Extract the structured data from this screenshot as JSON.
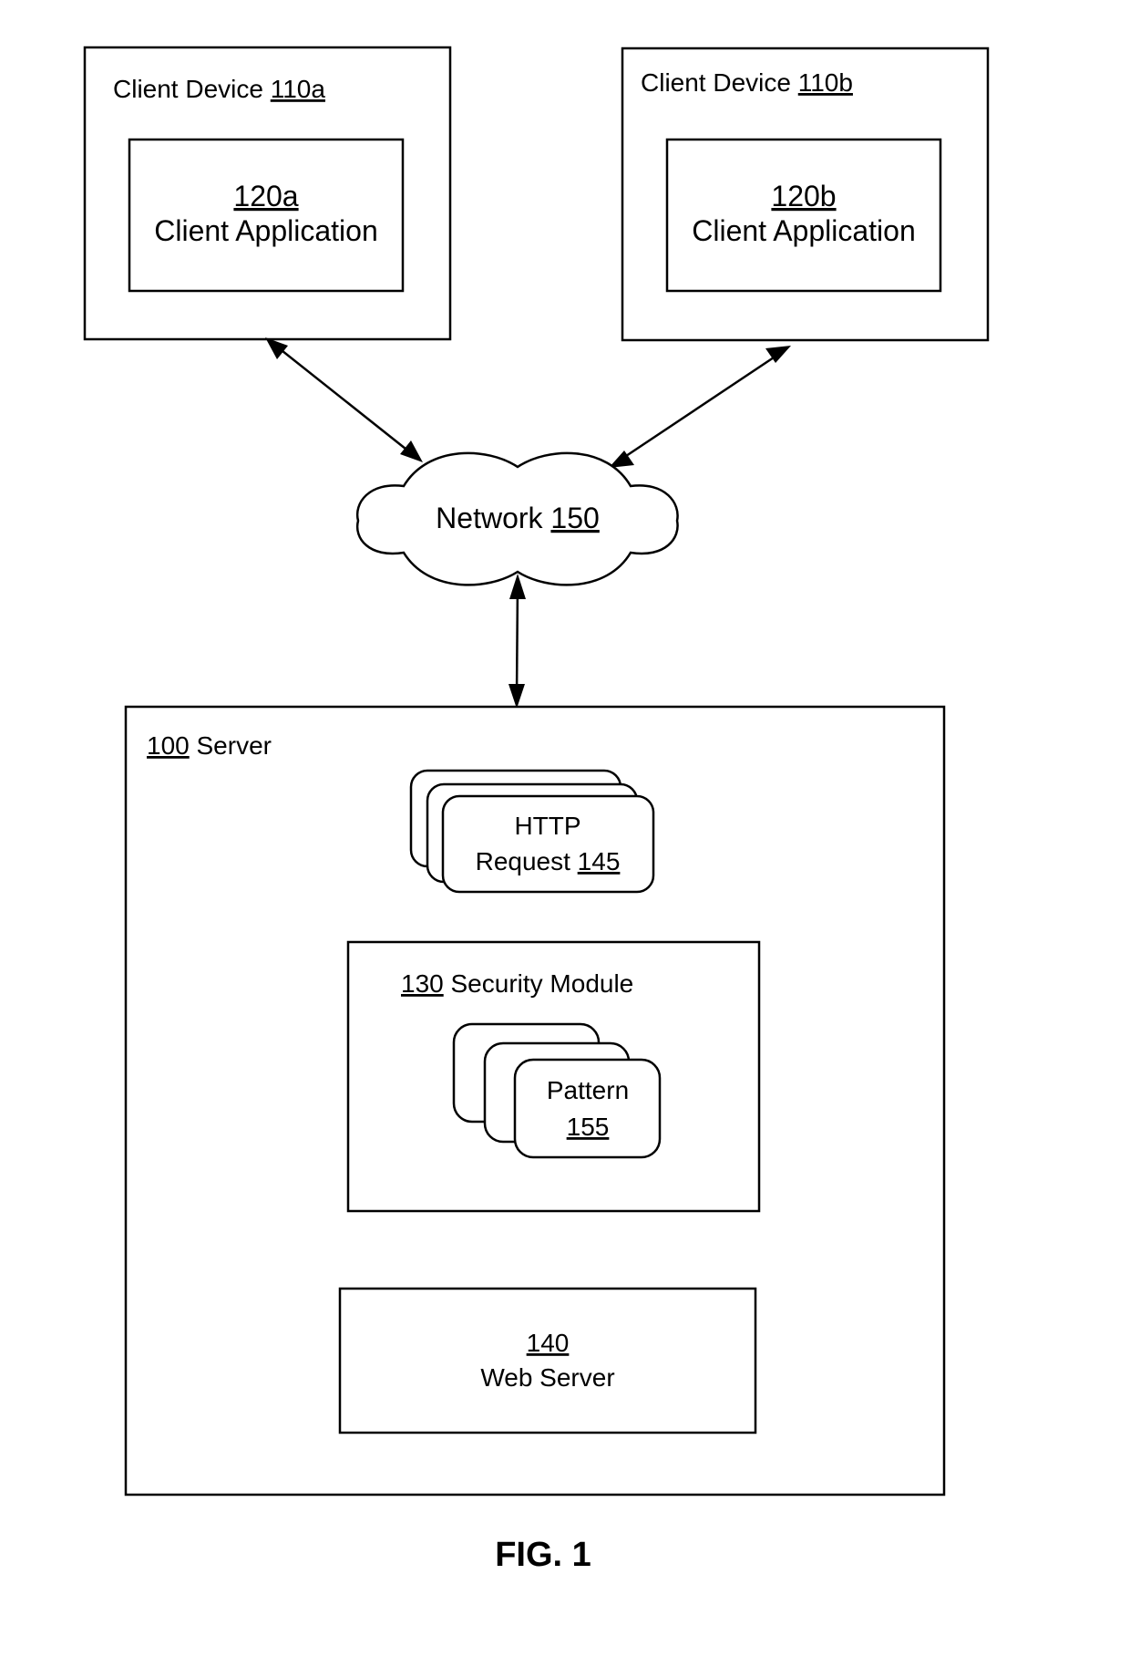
{
  "figure": {
    "caption": "FIG. 1"
  },
  "client_device_a": {
    "label": "Client Device ",
    "ref": "110a",
    "app": {
      "ref": "120a",
      "label": "Client Application"
    }
  },
  "client_device_b": {
    "label": "Client Device ",
    "ref": "110b",
    "app": {
      "ref": "120b",
      "label": "Client Application"
    }
  },
  "network": {
    "label": "Network ",
    "ref": "150",
    "icon": "cloud-icon"
  },
  "server": {
    "ref": "100",
    "label": " Server",
    "http_request": {
      "line1": "HTTP",
      "line2": "Request ",
      "ref": "145"
    },
    "security_module": {
      "ref": "130",
      "label": " Security Module",
      "pattern": {
        "label": "Pattern",
        "ref": "155"
      }
    },
    "web_server": {
      "ref": "140",
      "label": "Web Server"
    }
  },
  "connections": [
    {
      "from": "client_device_a",
      "to": "network",
      "type": "bidirectional"
    },
    {
      "from": "client_device_b",
      "to": "network",
      "type": "bidirectional"
    },
    {
      "from": "network",
      "to": "server",
      "type": "bidirectional"
    }
  ]
}
